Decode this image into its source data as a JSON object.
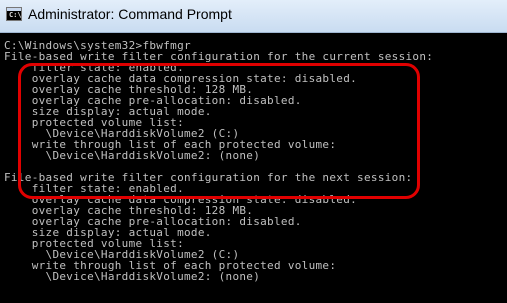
{
  "window": {
    "title": "Administrator: Command Prompt",
    "icon": "cmd-icon"
  },
  "console": {
    "lines": [
      "C:\\Windows\\system32>fbwfmgr",
      "File-based write filter configuration for the current session:",
      "    filter state: enabled.",
      "    overlay cache data compression state: disabled.",
      "    overlay cache threshold: 128 MB.",
      "    overlay cache pre-allocation: disabled.",
      "    size display: actual mode.",
      "    protected volume list:",
      "      \\Device\\HarddiskVolume2 (C:)",
      "    write through list of each protected volume:",
      "      \\Device\\HarddiskVolume2: (none)",
      "",
      "File-based write filter configuration for the next session:",
      "    filter state: enabled.",
      "    overlay cache data compression state: disabled.",
      "    overlay cache threshold: 128 MB.",
      "    overlay cache pre-allocation: disabled.",
      "    size display: actual mode.",
      "    protected volume list:",
      "      \\Device\\HarddiskVolume2 (C:)",
      "    write through list of each protected volume:",
      "      \\Device\\HarddiskVolume2: (none)"
    ]
  },
  "colors": {
    "console_bg": "#000000",
    "console_text": "#c0c0c0",
    "highlight": "#e00000"
  }
}
